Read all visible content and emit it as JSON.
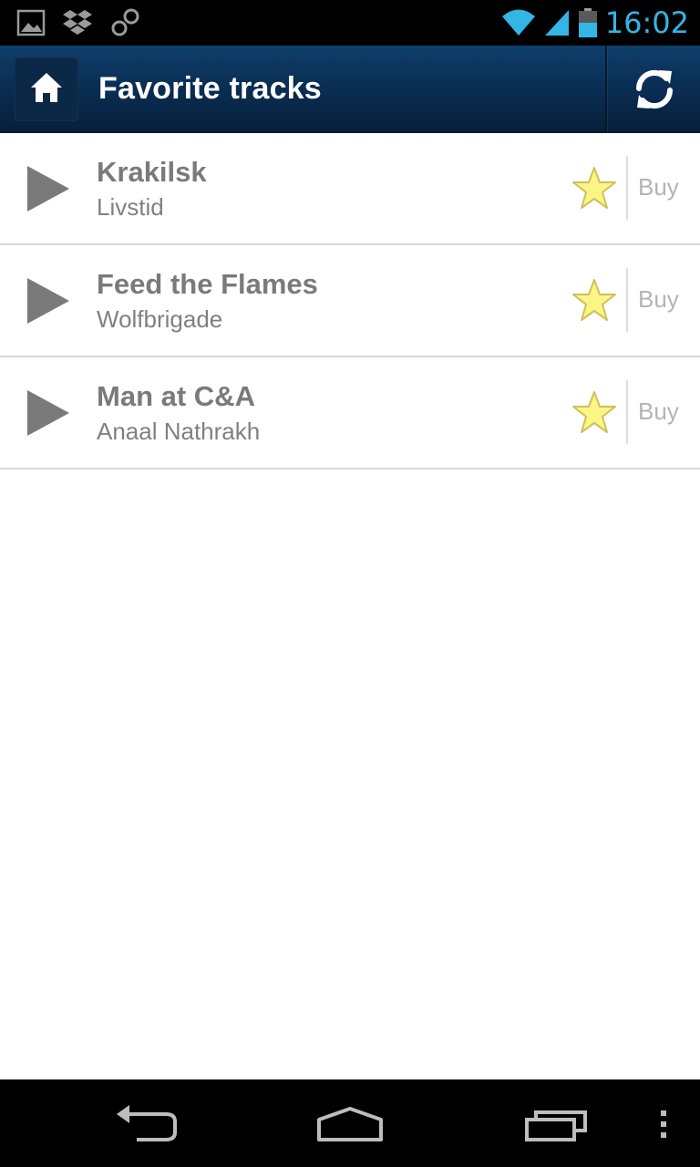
{
  "status_bar": {
    "time": "16:02",
    "icons": [
      "image-icon",
      "dropbox-icon",
      "infinity-icon",
      "wifi-icon",
      "signal-icon",
      "battery-icon"
    ],
    "time_color": "#33b5e5"
  },
  "action_bar": {
    "title": "Favorite tracks",
    "home_icon": "home-icon",
    "refresh_icon": "refresh-icon"
  },
  "tracks": [
    {
      "title": "Krakilsk",
      "artist": "Livstid",
      "buy_label": "Buy",
      "favorite": true
    },
    {
      "title": "Feed the Flames",
      "artist": "Wolfbrigade",
      "buy_label": "Buy",
      "favorite": true
    },
    {
      "title": "Man at C&A",
      "artist": "Anaal Nathrakh",
      "buy_label": "Buy",
      "favorite": true
    }
  ],
  "nav_bar": {
    "icons": [
      "back-icon",
      "home-nav-icon",
      "recents-icon",
      "menu-icon"
    ]
  },
  "colors": {
    "action_bar": "#0a2f55",
    "star_fill": "#fbf587",
    "play_icon": "#7a7a7a",
    "buy_text": "#b4b4b4"
  }
}
